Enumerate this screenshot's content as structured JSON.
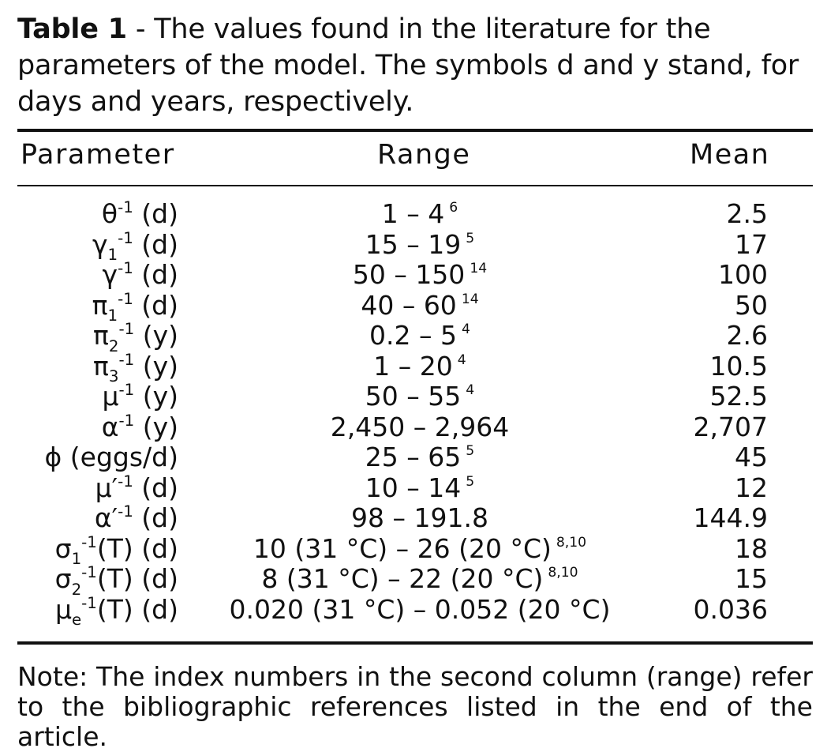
{
  "caption": {
    "label": "Table 1",
    "text": " - The values found in the literature for the parameters of the model. The symbols d and y stand, for days and years, respectively."
  },
  "table": {
    "headers": {
      "parameter": "Parameter",
      "range": "Range",
      "mean": "Mean"
    },
    "rows": [
      {
        "symbol": "θ",
        "sub": "",
        "sup": "-1",
        "post": "",
        "unit": " (d)",
        "range": "1 – 4",
        "ref": "6",
        "mean": "2.5"
      },
      {
        "symbol": "γ",
        "sub": "1",
        "sup": "-1",
        "post": "",
        "unit": " (d)",
        "range": "15 – 19",
        "ref": "5",
        "mean": "17"
      },
      {
        "symbol": "γ",
        "sub": "",
        "sup": "-1",
        "post": "",
        "unit": " (d)",
        "range": "50 – 150",
        "ref": "14",
        "mean": "100"
      },
      {
        "symbol": "π",
        "sub": "1",
        "sup": "-1",
        "post": "",
        "unit": " (d)",
        "range": "40 – 60",
        "ref": "14",
        "mean": "50"
      },
      {
        "symbol": "π",
        "sub": "2",
        "sup": "-1",
        "post": "",
        "unit": " (y)",
        "range": "0.2 – 5",
        "ref": "4",
        "mean": "2.6"
      },
      {
        "symbol": "π",
        "sub": "3",
        "sup": "-1",
        "post": "",
        "unit": " (y)",
        "range": "1 – 20",
        "ref": "4",
        "mean": "10.5"
      },
      {
        "symbol": "μ",
        "sub": "",
        "sup": "-1",
        "post": "",
        "unit": " (y)",
        "range": "50 – 55",
        "ref": "4",
        "mean": "52.5"
      },
      {
        "symbol": "α",
        "sub": "",
        "sup": "-1",
        "post": "",
        "unit": " (y)",
        "range": "2,450 – 2,964",
        "ref": "",
        "mean": "2,707"
      },
      {
        "symbol": "ϕ",
        "sub": "",
        "sup": "",
        "post": "",
        "unit": " (eggs/d)",
        "range": "25 – 65",
        "ref": "5",
        "mean": "45"
      },
      {
        "symbol": "μ′",
        "sub": "",
        "sup": "-1",
        "post": "",
        "unit": " (d)",
        "range": "10 – 14",
        "ref": "5",
        "mean": "12"
      },
      {
        "symbol": "α′",
        "sub": "",
        "sup": "-1",
        "post": "",
        "unit": " (d)",
        "range": "98 – 191.8",
        "ref": "",
        "mean": "144.9"
      },
      {
        "symbol": "σ",
        "sub": "1",
        "sup": "-1",
        "post": "(T)",
        "unit": " (d)",
        "range": "10 (31 °C) – 26 (20 °C)",
        "ref": "8,10",
        "mean": "18"
      },
      {
        "symbol": "σ",
        "sub": "2",
        "sup": "-1",
        "post": "(T)",
        "unit": " (d)",
        "range": "8 (31 °C) – 22 (20 °C)",
        "ref": "8,10",
        "mean": "15"
      },
      {
        "symbol": "μ",
        "sub": "e",
        "sup": "-1",
        "post": "(T)",
        "unit": " (d)",
        "range": "0.020 (31 °C) – 0.052 (20 °C)",
        "ref": "",
        "mean": "0.036"
      }
    ]
  },
  "note": "Note: The index numbers in the second column (range) refer to the bibliographic references listed in the end of the article."
}
